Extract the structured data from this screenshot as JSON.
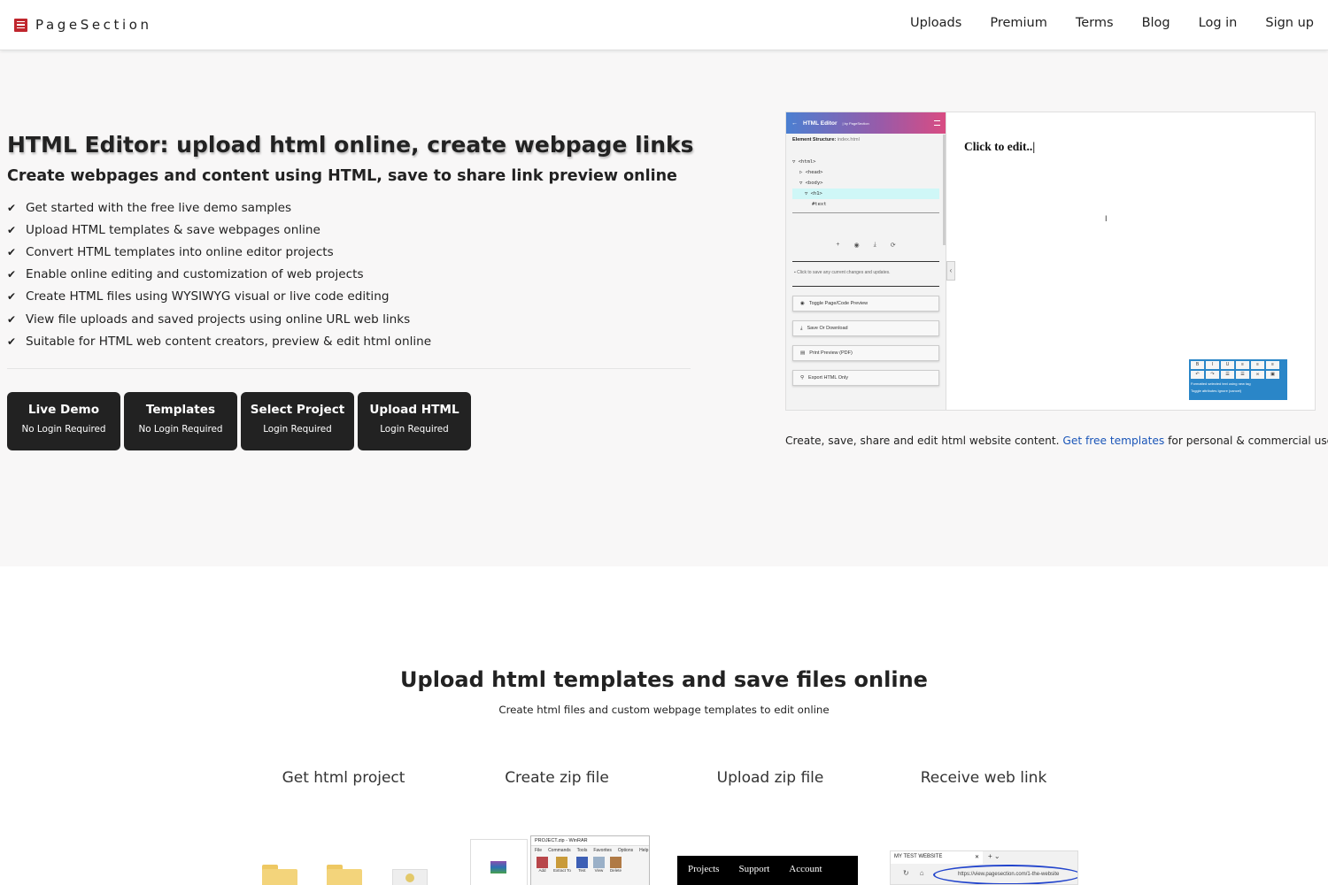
{
  "header": {
    "brand": "PageSection",
    "nav": [
      "Uploads",
      "Premium",
      "Terms",
      "Blog",
      "Log in",
      "Sign up"
    ]
  },
  "hero": {
    "title": "HTML Editor: upload html online, create webpage links",
    "subtitle": "Create webpages and content using HTML, save to share link preview online",
    "features": [
      "Get started with the free live demo samples",
      "Upload HTML templates & save webpages online",
      "Convert HTML templates into online editor projects",
      "Enable online editing and customization of web projects",
      "Create HTML files using WYSIWYG visual or live code editing",
      "View file uploads and saved projects using online URL web links",
      "Suitable for HTML web content creators, preview & edit html online"
    ],
    "buttons": [
      {
        "label": "Live Demo",
        "sub": "No Login Required"
      },
      {
        "label": "Templates",
        "sub": "No Login Required"
      },
      {
        "label": "Select Project",
        "sub": "Login Required"
      },
      {
        "label": "Upload HTML",
        "sub": "Login Required"
      }
    ]
  },
  "preview": {
    "header_title": "HTML Editor",
    "header_by": "| by PageSection",
    "structure_label": "Element Structure:",
    "structure_file": "index.html",
    "tree": [
      "▽ <html>",
      "▷ <head>",
      "▽ <body>",
      "▽ <h1>",
      "#text"
    ],
    "icons": [
      "+",
      "◉",
      "⤓",
      "⟳"
    ],
    "save_note": "Click to save any current changes and updates.",
    "side_buttons": [
      "Toggle Page/Code Preview",
      "Save Or Download",
      "Print Preview (PDF)",
      "Export HTML Only"
    ],
    "canvas_text": "Click to edit..",
    "toolbar_note": "Formatted selected text using new tag",
    "toolbar_options": "Toggle attributes   Ignore (cancel)"
  },
  "caption": {
    "before": "Create, save, share and edit html website content.",
    "link": "Get free templates",
    "after": "for personal & commercial use 🚀"
  },
  "section2": {
    "title": "Upload html templates and save files online",
    "subtitle": "Create html files and custom webpage templates to edit online",
    "steps": [
      "Get html project",
      "Create zip file",
      "Upload zip file",
      "Receive web link"
    ]
  },
  "winrar": {
    "title": "PROJECT.zip - WinRAR",
    "menu": [
      "File",
      "Commands",
      "Tools",
      "Favorites",
      "Options",
      "Help"
    ],
    "tools": [
      "Add",
      "Extract To",
      "Test",
      "View",
      "Delete"
    ]
  },
  "upload_site": {
    "nav": [
      "Projects",
      "Support",
      "Account"
    ]
  },
  "browser": {
    "tab": "MY TEST WEBSITE",
    "url": "https://view.pagesection.com/1-the-website"
  },
  "colors": {
    "brand": "#c0262d",
    "button_bg": "#222222",
    "link": "#1a55b8",
    "hero_bg": "#f8f7f7"
  }
}
